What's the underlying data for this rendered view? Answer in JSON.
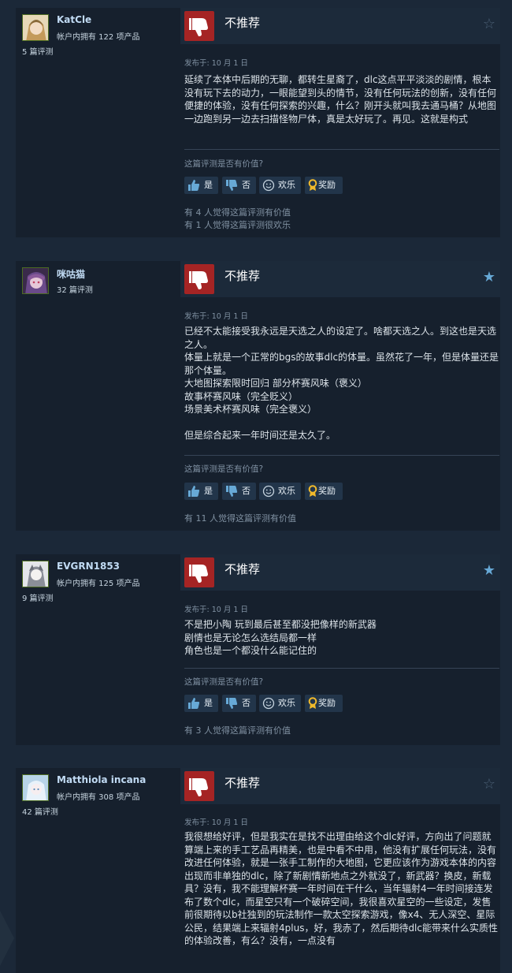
{
  "ui": {
    "helpful_question": "这篇评测是否有价值?",
    "yes_label": "是",
    "no_label": "否",
    "funny_label": "欢乐",
    "award_label": "奖励",
    "colors": {
      "page_bg": "#1b2838",
      "card_bg": "#16202d",
      "not_recommended": "#a52424",
      "star_filled": "#67a9d6"
    },
    "icons": [
      "thumbs-down-icon",
      "star-icon",
      "thumbs-up-icon",
      "smiley-icon",
      "award-icon"
    ]
  },
  "reviews": [
    {
      "author": "KatCle",
      "games_owned": "帐户内拥有 122 项产品",
      "review_count": "5 篇评测",
      "recommendation": "不推荐",
      "star_filled": false,
      "posted": "发布于: 10 月 1 日",
      "body": [
        "延续了本体中后期的无聊，都转生星裔了，dlc这点平平淡淡的剧情，根本没有玩下去的动力，一眼能望到头的情节，没有任何玩法的创新，没有任何便捷的体验，没有任何探索的兴趣，什么？刚开头就叫我去通马桶？从地图一边跑到另一边去扫描怪物尸体，真是太好玩了。再见。这就是构式"
      ],
      "helpful_stats": [
        "有 4 人觉得这篇评测有价值",
        "有 1 人觉得这篇评测很欢乐"
      ]
    },
    {
      "author": "咪咕猫",
      "review_count": "32 篇评测",
      "recommendation": "不推荐",
      "star_filled": true,
      "posted": "发布于: 10 月 1 日",
      "body": [
        "已经不太能接受我永远是天选之人的设定了。啥都天选之人。到这也是天选之人。",
        "体量上就是一个正常的bgs的故事dlc的体量。虽然花了一年，但是体量还是那个体量。",
        "大地图探索限时回归 部分杯赛风味（褒义）",
        "故事杯赛风味（完全贬义）",
        "场景美术杯赛风味（完全褒义）",
        "",
        "但是综合起来一年时间还是太久了。"
      ],
      "helpful_stats": [
        "有 11 人觉得这篇评测有价值"
      ]
    },
    {
      "author": "EVGRN1853",
      "games_owned": "帐户内拥有 125 项产品",
      "review_count": "9 篇评测",
      "recommendation": "不推荐",
      "star_filled": true,
      "posted": "发布于: 10 月 1 日",
      "body": [
        "不是把小陶 玩到最后甚至都没把像样的新武器",
        "剧情也是无论怎么选结局都一样",
        "角色也是一个都没什么能记住的"
      ],
      "helpful_stats": [
        "有 3 人觉得这篇评测有价值"
      ]
    },
    {
      "author": "Matthiola incana",
      "games_owned": "帐户内拥有 308 项产品",
      "review_count": "42 篇评测",
      "recommendation": "不推荐",
      "star_filled": false,
      "posted": "发布于: 10 月 1 日",
      "body": [
        "我很想给好评，但是我实在是找不出理由给这个dlc好评，方向出了问题就算端上来的手工艺品再精美，也是中看不中用，他没有扩展任何玩法，没有改进任何体验，就是一张手工制作的大地图，它更应该作为游戏本体的内容出现而非单独的dlc，除了新剧情新地点之外就没了，新武器？换皮，新载具？没有，我不能理解杯赛一年时间在干什么，当年辐射4一年时间接连发布了数个dlc，而星空只有一个破碎空间，我很喜欢星空的一些设定，发售前很期待以b社独到的玩法制作一款太空探索游戏，像x4、无人深空、星际公民，结果端上来辐射4plus，好，我赤了，然后期待dlc能带来什么实质性的体验改善，有么？没有，一点没有"
      ]
    }
  ]
}
